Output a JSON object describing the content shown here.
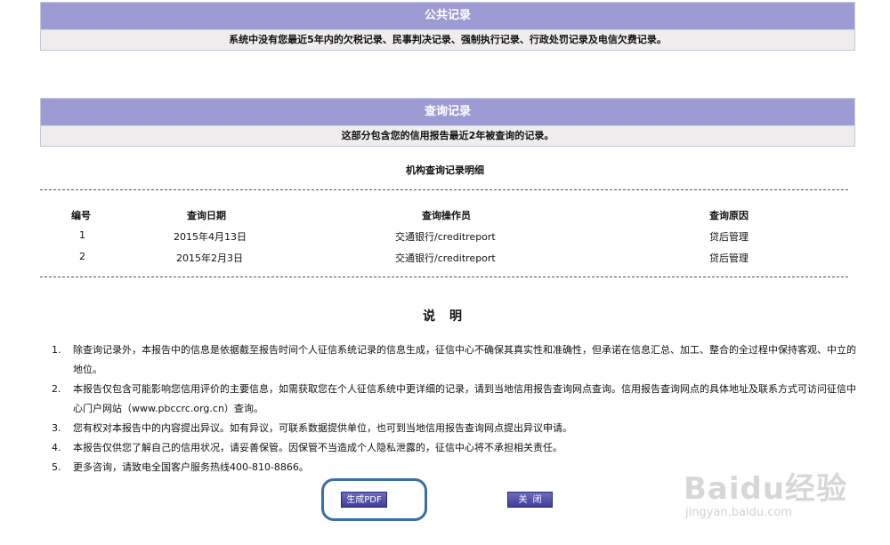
{
  "public_section": {
    "title": "公共记录",
    "message": "系统中没有您最近5年内的欠税记录、民事判决记录、强制执行记录、行政处罚记录及电信欠费记录。"
  },
  "query_section": {
    "title": "查询记录",
    "message": "这部分包含您的信用报告最近2年被查询的记录。",
    "detail_title": "机构查询记录明细",
    "columns": [
      "编号",
      "查询日期",
      "查询操作员",
      "查询原因"
    ],
    "rows": [
      [
        "1",
        "2015年4月13日",
        "交通银行/creditreport",
        "贷后管理"
      ],
      [
        "2",
        "2015年2月3日",
        "交通银行/creditreport",
        "贷后管理"
      ]
    ]
  },
  "notes": {
    "title": "说明",
    "items": [
      {
        "num": "1.",
        "text": "除查询记录外，本报告中的信息是依据截至报告时间个人征信系统记录的信息生成，征信中心不确保其真实性和准确性，但承诺在信息汇总、加工、整合的全过程中保持客观、中立的地位。"
      },
      {
        "num": "2.",
        "text": "本报告仅包含可能影响您信用评价的主要信息，如需获取您在个人征信系统中更详细的记录，请到当地信用报告查询网点查询。信用报告查询网点的具体地址及联系方式可访问征信中心门户网站（www.pbccrc.org.cn）查询。"
      },
      {
        "num": "3.",
        "text": "您有权对本报告中的内容提出异议。如有异议，可联系数据提供单位，也可到当地信用报告查询网点提出异议申请。"
      },
      {
        "num": "4.",
        "text": "本报告仅供您了解自己的信用状况，请妥善保管。因保管不当造成个人隐私泄露的，征信中心将不承担相关责任。"
      },
      {
        "num": "5.",
        "text": "更多咨询，请致电全国客户服务热线400-810-8866。"
      }
    ]
  },
  "buttons": {
    "pdf": "生成PDF",
    "close": "关闭"
  },
  "watermark": {
    "logo": "Baidu经验",
    "url": "jingyan.baidu.com"
  },
  "colors": {
    "header_bg": "#9d9bd3",
    "body_bg": "#efecee",
    "button_bg": "#4b49a3",
    "highlight_ring": "#3a6ea5"
  }
}
